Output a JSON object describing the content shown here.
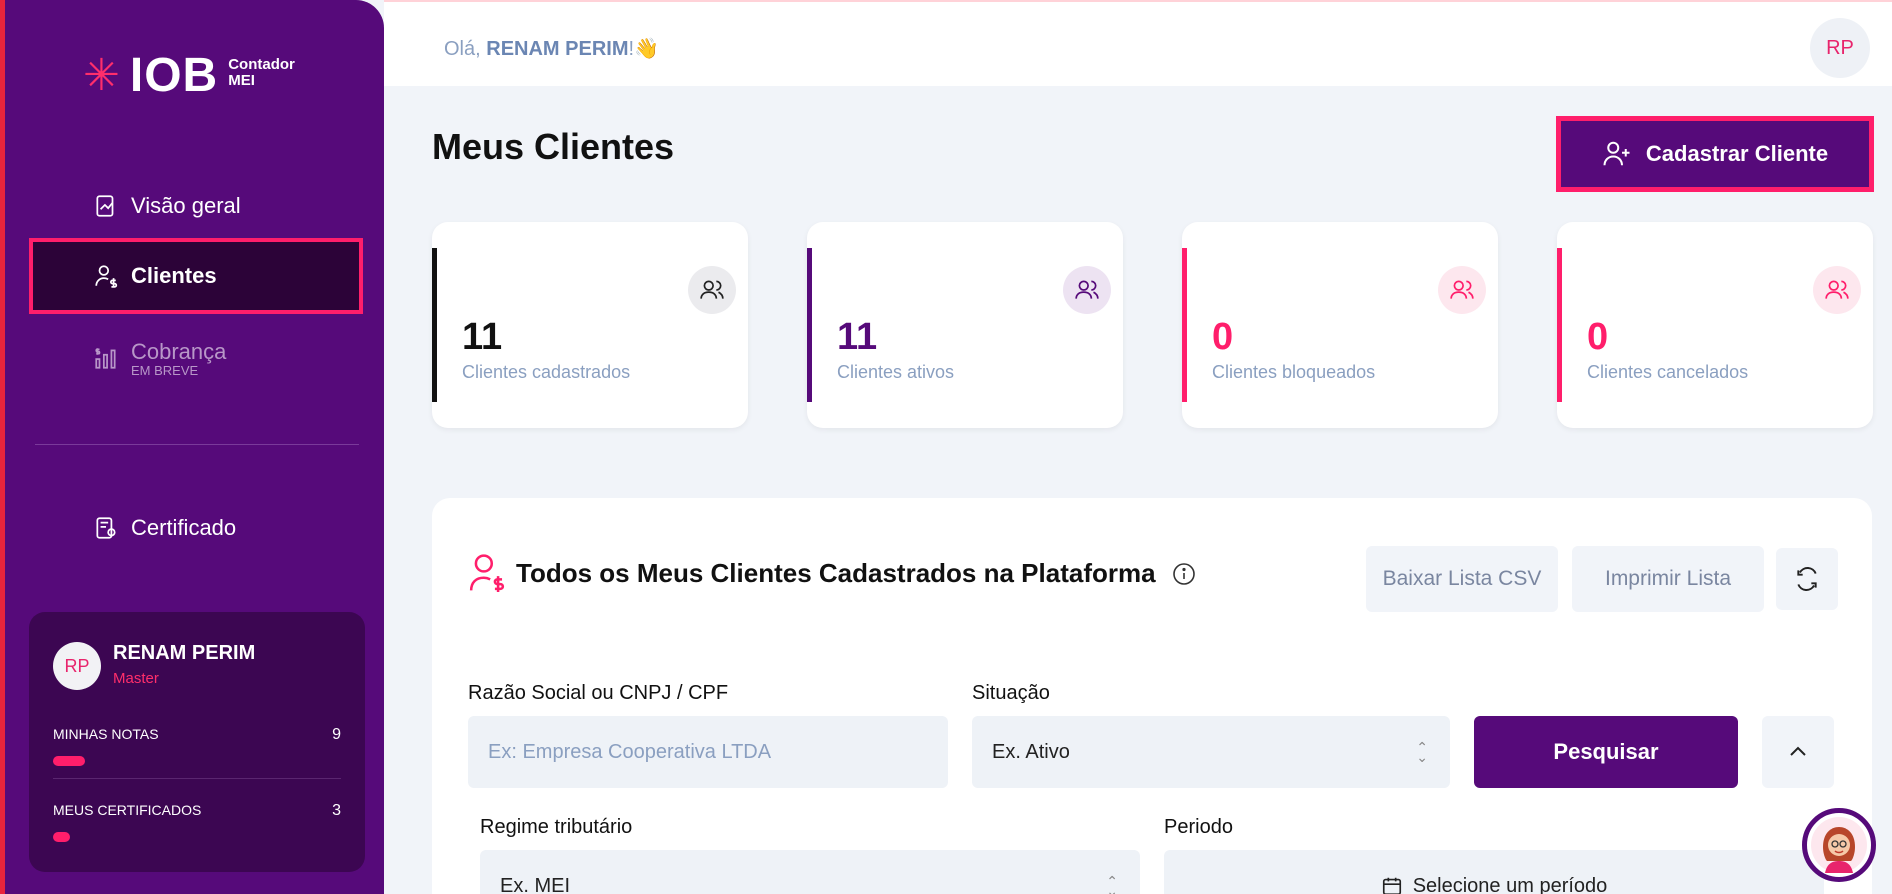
{
  "brand": {
    "logo_mark": "IOB",
    "logo_sub_line1": "Contador",
    "logo_sub_line2": "MEI"
  },
  "sidebar": {
    "items": [
      {
        "label": "Visão geral",
        "icon": "chart-icon"
      },
      {
        "label": "Clientes",
        "icon": "users-dollar-icon",
        "active": true
      },
      {
        "label": "Cobrança",
        "sub": "EM BREVE",
        "icon": "bars-dollar-icon",
        "disabled": true
      },
      {
        "label": "Certificado",
        "icon": "certificate-icon"
      }
    ],
    "user": {
      "initials": "RP",
      "name": "RENAM PERIM",
      "role": "Master",
      "stats": [
        {
          "label": "MINHAS NOTAS",
          "value": "9",
          "fill": 0.11
        },
        {
          "label": "MEUS CERTIFICADOS",
          "value": "3",
          "fill": 0.06
        }
      ]
    }
  },
  "header": {
    "greeting_prefix": "Olá, ",
    "greeting_name": "RENAM PERIM",
    "greeting_suffix": "!👋",
    "avatar_initials": "RP"
  },
  "main": {
    "title": "Meus Clientes",
    "add_button": "Cadastrar Cliente",
    "stats": [
      {
        "value": "11",
        "label": "Clientes cadastrados",
        "color": "#111111",
        "icon_bg": "#ebebee",
        "icon_color": "#222222"
      },
      {
        "value": "11",
        "label": "Clientes ativos",
        "color": "#560a7a",
        "icon_bg": "#ede3f2",
        "icon_color": "#560a7a"
      },
      {
        "value": "0",
        "label": "Clientes bloqueados",
        "color": "#ff1e6b",
        "icon_bg": "#fde7ee",
        "icon_color": "#ff1e6b"
      },
      {
        "value": "0",
        "label": "Clientes cancelados",
        "color": "#ff1e6b",
        "icon_bg": "#fde7ee",
        "icon_color": "#ff1e6b"
      }
    ],
    "panel": {
      "title": "Todos os Meus Clientes Cadastrados na Plataforma",
      "download_csv": "Baixar Lista CSV",
      "print_list": "Imprimir Lista",
      "filters": {
        "name_label": "Razão Social ou CNPJ / CPF",
        "name_placeholder": "Ex: Empresa Cooperativa LTDA",
        "situation_label": "Situação",
        "situation_value": "Ex. Ativo",
        "search_button": "Pesquisar",
        "regime_label": "Regime tributário",
        "regime_value": "Ex. MEI",
        "period_label": "Periodo",
        "period_value": "Selecione um período"
      }
    }
  },
  "colors": {
    "primary": "#560a7a",
    "accent": "#ff1e6b"
  }
}
